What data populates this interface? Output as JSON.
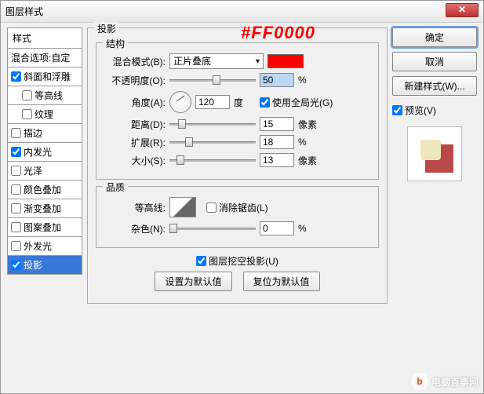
{
  "title": "图层样式",
  "annotation": "#FF0000",
  "left": {
    "header": "样式",
    "blend": "混合选项:自定",
    "items": [
      {
        "label": "斜面和浮雕",
        "checked": true,
        "indent": false
      },
      {
        "label": "等高线",
        "checked": false,
        "indent": true
      },
      {
        "label": "纹理",
        "checked": false,
        "indent": true
      },
      {
        "label": "描边",
        "checked": false,
        "indent": false
      },
      {
        "label": "内发光",
        "checked": true,
        "indent": false
      },
      {
        "label": "光泽",
        "checked": false,
        "indent": false
      },
      {
        "label": "颜色叠加",
        "checked": false,
        "indent": false
      },
      {
        "label": "渐变叠加",
        "checked": false,
        "indent": false
      },
      {
        "label": "图案叠加",
        "checked": false,
        "indent": false
      },
      {
        "label": "外发光",
        "checked": false,
        "indent": false
      },
      {
        "label": "投影",
        "checked": true,
        "indent": false,
        "selected": true
      }
    ]
  },
  "mid": {
    "group_title": "投影",
    "structure_title": "结构",
    "blend_mode_label": "混合模式(B):",
    "blend_mode_value": "正片叠底",
    "swatch_color": "#ff0000",
    "opacity_label": "不透明度(O):",
    "opacity_value": "50",
    "opacity_unit": "%",
    "angle_label": "角度(A):",
    "angle_value": "120",
    "angle_unit": "度",
    "global_light": "使用全局光(G)",
    "distance_label": "距离(D):",
    "distance_value": "15",
    "distance_unit": "像素",
    "spread_label": "扩展(R):",
    "spread_value": "18",
    "spread_unit": "%",
    "size_label": "大小(S):",
    "size_value": "13",
    "size_unit": "像素",
    "quality_title": "品质",
    "contour_label": "等高线:",
    "antialias": "消除锯齿(L)",
    "noise_label": "杂色(N):",
    "noise_value": "0",
    "noise_unit": "%",
    "knockout": "图层挖空投影(U)",
    "set_default": "设置为默认值",
    "reset_default": "复位为默认值"
  },
  "right": {
    "ok": "确定",
    "cancel": "取消",
    "new_style": "新建样式(W)...",
    "preview": "预览(V)"
  },
  "watermark": "电脑百事网"
}
